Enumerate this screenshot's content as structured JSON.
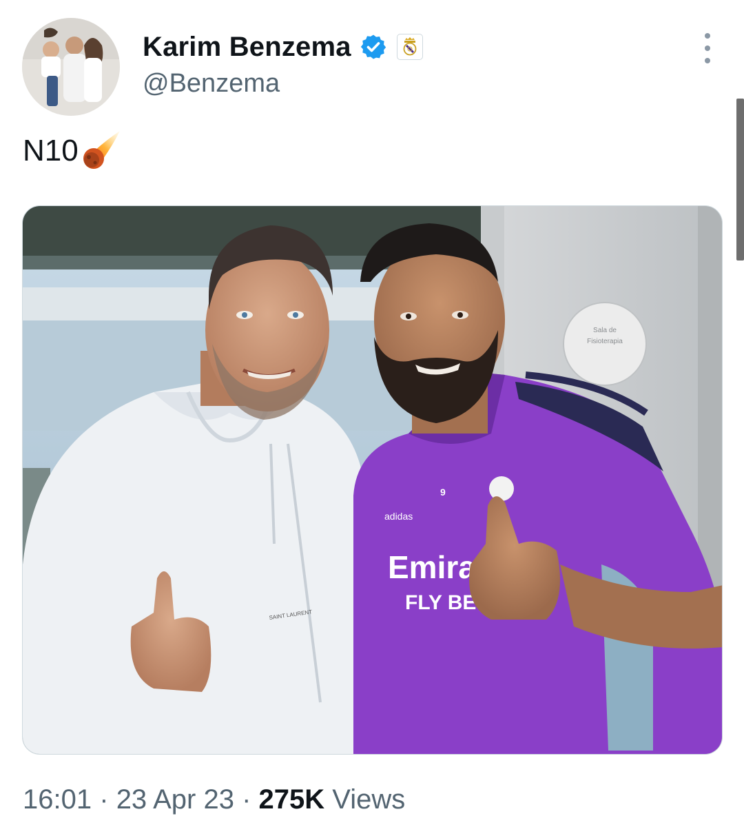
{
  "author": {
    "display_name": "Karim Benzema",
    "handle": "@Benzema",
    "verified": true,
    "affiliate_badge": "real-madrid-crest-icon",
    "avatar": "family-photo-avatar"
  },
  "tweet": {
    "text": "N10",
    "emoji": "comet-icon",
    "media_description_icon": "photo-two-men-thumbs-up"
  },
  "photo_text": {
    "sign": "Sala de Fisioterapia",
    "jersey_sponsor_line1": "Emira",
    "jersey_sponsor_line2": "FLY BET",
    "jersey_number": "9",
    "jersey_brand": "adidas",
    "hoodie_brand": "SAINT LAURENT"
  },
  "meta": {
    "time": "16:01",
    "separator": "·",
    "date": "23 Apr 23",
    "views_count": "275K",
    "views_label": "Views"
  },
  "colors": {
    "verified_blue": "#1d9bf0",
    "text_primary": "#0f1419",
    "text_secondary": "#536471",
    "jersey_purple": "#8a3fc8"
  }
}
